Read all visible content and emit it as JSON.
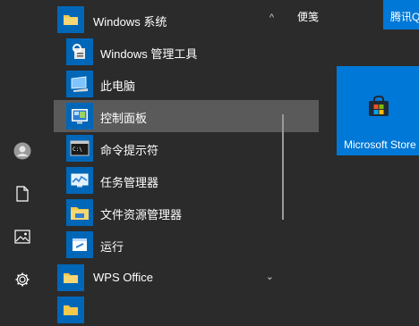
{
  "rail": {
    "items": [
      {
        "icon": "avatar"
      },
      {
        "icon": "document-icon"
      },
      {
        "icon": "pictures-icon"
      },
      {
        "icon": "gear-icon"
      }
    ]
  },
  "list": {
    "group_windows": {
      "label": "Windows 系统",
      "chevron": "^"
    },
    "items": [
      {
        "label": "Windows 管理工具",
        "icon": "admin-tools-icon"
      },
      {
        "label": "此电脑",
        "icon": "computer-icon"
      },
      {
        "label": "控制面板",
        "icon": "control-panel-icon"
      },
      {
        "label": "命令提示符",
        "icon": "command-prompt-icon"
      },
      {
        "label": "任务管理器",
        "icon": "task-manager-icon"
      },
      {
        "label": "文件资源管理器",
        "icon": "file-explorer-icon"
      },
      {
        "label": "运行",
        "icon": "run-icon"
      }
    ],
    "group_wps": {
      "label": "WPS Office",
      "chevron": "⌄"
    }
  },
  "tiles": {
    "notes_label": "便笺",
    "tencent_label": "腾讯Q",
    "store_label": "Microsoft Store"
  },
  "colors": {
    "accent": "#0078d7",
    "background": "#2b2b2b",
    "selected": "#5a5a5a"
  }
}
